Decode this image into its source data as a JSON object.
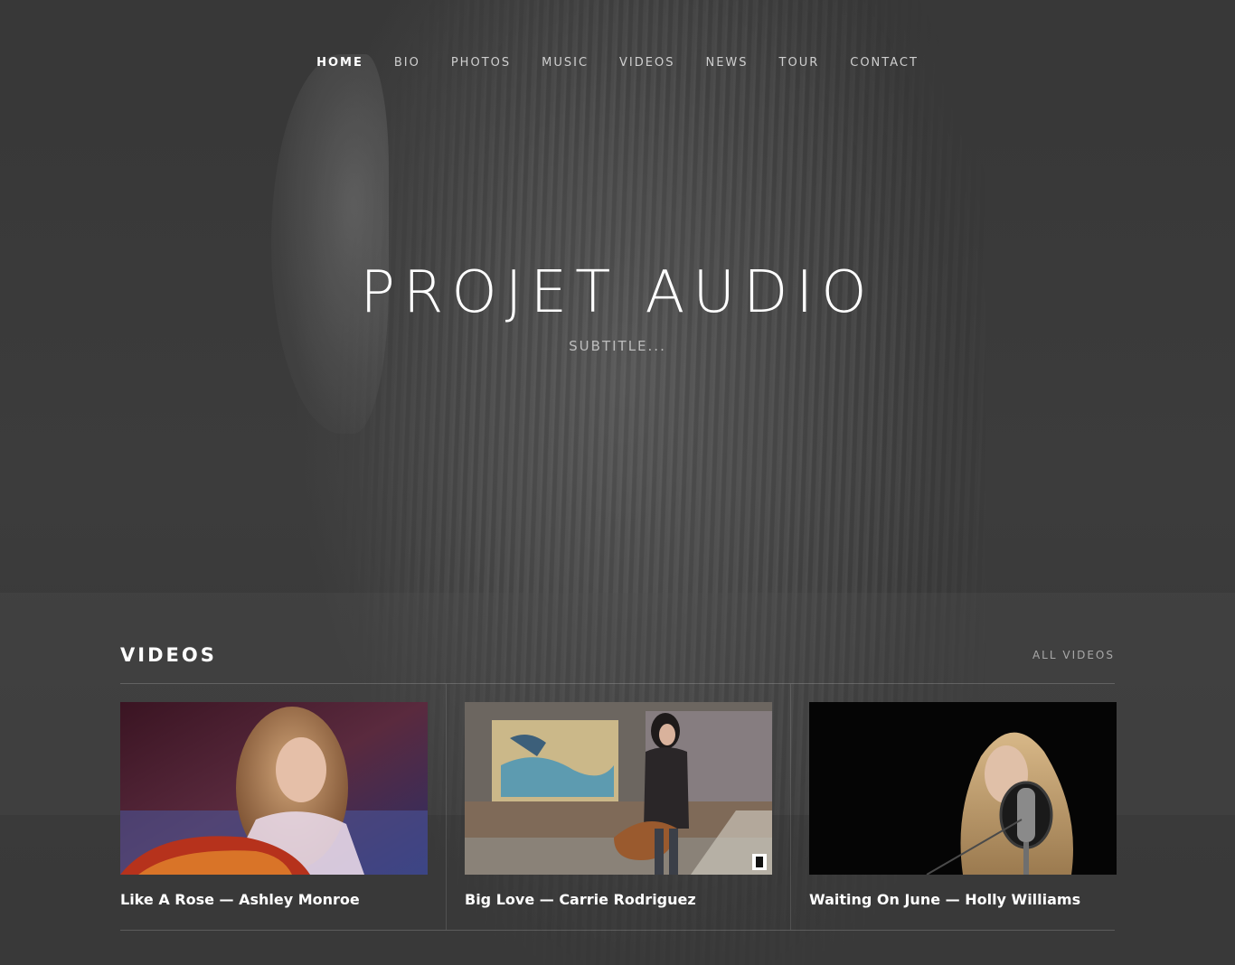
{
  "nav": {
    "items": [
      {
        "label": "HOME",
        "active": true
      },
      {
        "label": "BIO"
      },
      {
        "label": "PHOTOS"
      },
      {
        "label": "MUSIC"
      },
      {
        "label": "VIDEOS"
      },
      {
        "label": "NEWS"
      },
      {
        "label": "TOUR"
      },
      {
        "label": "CONTACT"
      }
    ]
  },
  "hero": {
    "title": "PROJET AUDIO",
    "subtitle": "SUBTITLE..."
  },
  "videos": {
    "heading": "VIDEOS",
    "all_link": "ALL VIDEOS",
    "items": [
      {
        "caption": "Like A Rose — Ashley Monroe"
      },
      {
        "caption": "Big Love — Carrie Rodriguez"
      },
      {
        "caption": "Waiting On June — Holly Williams"
      }
    ]
  }
}
